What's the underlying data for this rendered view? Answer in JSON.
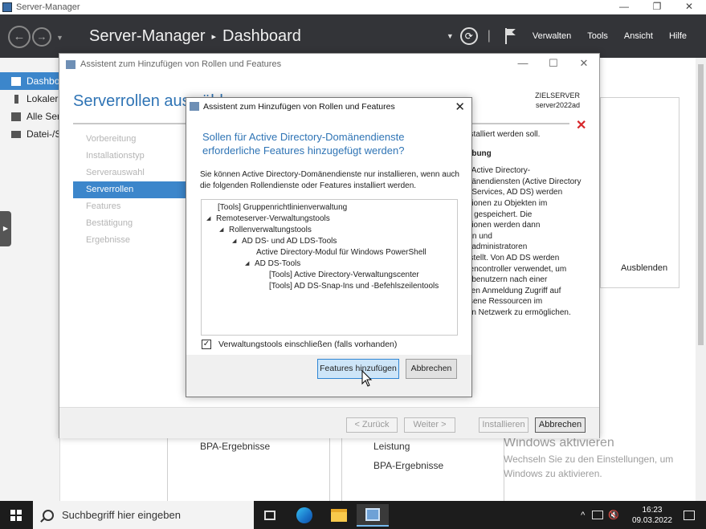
{
  "os_window": {
    "title": "Server-Manager",
    "minimize": "—",
    "restore": "❐",
    "close": "✕"
  },
  "header": {
    "app_name": "Server-Manager",
    "separator": "▸",
    "page": "Dashboard",
    "back": "←",
    "forward": "→",
    "history_dropdown": "▼",
    "notifications_dropdown": "▼",
    "refresh": "⟳",
    "pipe": "|",
    "menus": [
      "Verwalten",
      "Tools",
      "Ansicht",
      "Hilfe"
    ]
  },
  "sidebar": {
    "items": [
      {
        "label": "Dashboard"
      },
      {
        "label": "Lokaler Server"
      },
      {
        "label": "Alle Server"
      },
      {
        "label": "Datei-/Speicherdienste"
      }
    ],
    "collapse_tab": "▶"
  },
  "dashboard": {
    "tiles": [
      {
        "label": "BPA-Ergebnisse"
      },
      {
        "label": "Leistung"
      },
      {
        "label": "BPA-Ergebnisse"
      }
    ],
    "hide_button": "Ausblenden"
  },
  "watermark": {
    "title": "Windows aktivieren",
    "text": "Wechseln Sie zu den Einstellungen, um Windows zu aktivieren."
  },
  "wizard": {
    "title": "Assistent zum Hinzufügen von Rollen und Features",
    "heading": "Serverrollen auswählen",
    "target_label": "ZIELSERVER",
    "target_value": "server2022ad",
    "steps": [
      {
        "label": "Vorbereitung"
      },
      {
        "label": "Installationstyp"
      },
      {
        "label": "Serverauswahl"
      },
      {
        "label": "Serverrollen"
      },
      {
        "label": "Features"
      },
      {
        "label": "Bestätigung"
      },
      {
        "label": "Ergebnisse"
      }
    ],
    "desc_top": "nstalliert werden soll.",
    "desc_head": "eibung",
    "desc_lines": [
      "n Active Directory-",
      "mänendiensten (Active Directory",
      "n Services, AD DS) werden",
      "ationen zu Objekten im",
      "rk gespeichert. Die",
      "ationen werden dann",
      "ern und",
      "rkadministratoren",
      "estellt. Von AD DS werden",
      "nencontroller verwendet, um",
      "rkbenutzern nach einer",
      "igen Anmeldung Zugriff auf",
      "ssene Ressourcen im",
      "ten Netzwerk zu ermöglichen."
    ],
    "buttons": {
      "back": "< Zurück",
      "next": "Weiter >",
      "install": "Installieren",
      "cancel": "Abbrechen"
    }
  },
  "dialog": {
    "title": "Assistent zum Hinzufügen von Rollen und Features",
    "close": "✕",
    "heading": "Sollen für Active Directory-Domänendienste erforderliche Features hinzugefügt werden?",
    "body": "Sie können Active Directory-Domänendienste nur installieren, wenn auch die folgenden Rollendienste oder Features installiert werden.",
    "tree": [
      {
        "label": "[Tools] Gruppenrichtlinienverwaltung",
        "expanded": false
      },
      {
        "label": "Remoteserver-Verwaltungstools",
        "expanded": true
      },
      {
        "label": "Rollenverwaltungstools",
        "expanded": true
      },
      {
        "label": "AD DS- und AD LDS-Tools",
        "expanded": true
      },
      {
        "label": "Active Directory-Modul für Windows PowerShell",
        "expanded": false
      },
      {
        "label": "AD DS-Tools",
        "expanded": true
      },
      {
        "label": "[Tools] Active Directory-Verwaltungscenter",
        "expanded": false
      },
      {
        "label": "[Tools] AD DS-Snap-Ins und -Befehlszeilentools",
        "expanded": false
      }
    ],
    "checkbox_label": "Verwaltungstools einschließen (falls vorhanden)",
    "checkbox_mark": "✓",
    "add_button": "Features hinzufügen",
    "cancel_button": "Abbrechen"
  },
  "taskbar": {
    "search_placeholder": "Suchbegriff hier eingeben",
    "time": "16:23",
    "date": "09.03.2022",
    "overflow": "^",
    "volume": "🔇"
  }
}
